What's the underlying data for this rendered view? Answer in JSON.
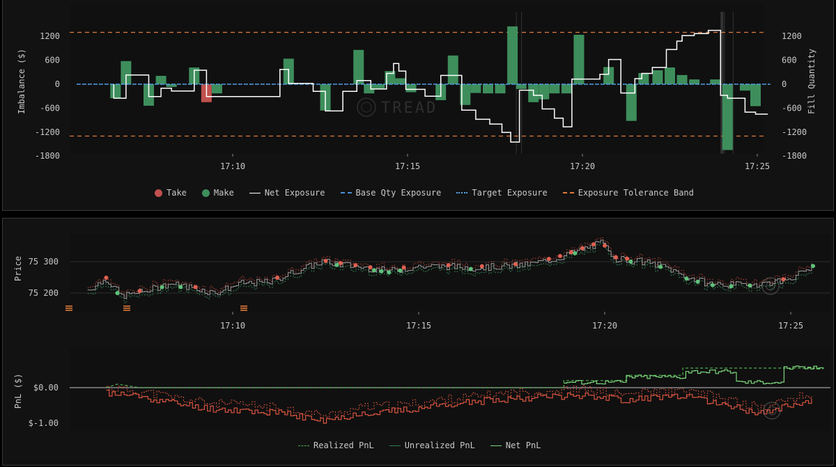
{
  "colors": {
    "take": "#c0504d",
    "make": "#3e8e5c",
    "net_exposure": "#ffffff",
    "base_qty": "#4a90d9",
    "target": "#5aa5e6",
    "tolerance": "#e07b39",
    "realized_pnl": "#4caf50",
    "unrealized_pnl": "#2e7d4f",
    "net_pnl": "#7cd67c",
    "pnl_negative": "#d9543f"
  },
  "chart_data": [
    {
      "type": "bar",
      "panel": "exposure",
      "ylabel_left": "Imbalance ($)",
      "ylabel_right": "Fill Quantity",
      "yticks": [
        "1200",
        "600",
        "0",
        "-600",
        "-1200",
        "-1800"
      ],
      "ylim": [
        -1800,
        1500
      ],
      "xticks": [
        "17:10",
        "17:15",
        "17:20",
        "17:25"
      ],
      "tolerance_band": [
        1300,
        -1300
      ],
      "legend": [
        "Take",
        "Make",
        "Net Exposure",
        "Base Qty Exposure",
        "Target Exposure",
        "Exposure Tolerance Band"
      ],
      "fills": [
        {
          "t": 6.65,
          "v": -350,
          "side": "make"
        },
        {
          "t": 6.95,
          "v": 580,
          "side": "make"
        },
        {
          "t": 7.6,
          "v": -540,
          "side": "make"
        },
        {
          "t": 7.95,
          "v": 210,
          "side": "make"
        },
        {
          "t": 8.25,
          "v": -70,
          "side": "make"
        },
        {
          "t": 8.9,
          "v": 420,
          "side": "make"
        },
        {
          "t": 9.25,
          "v": -450,
          "side": "take"
        },
        {
          "t": 9.55,
          "v": -230,
          "side": "make"
        },
        {
          "t": 11.6,
          "v": 640,
          "side": "make"
        },
        {
          "t": 12.65,
          "v": -660,
          "side": "make"
        },
        {
          "t": 13.6,
          "v": 860,
          "side": "make"
        },
        {
          "t": 13.9,
          "v": -230,
          "side": "make"
        },
        {
          "t": 14.2,
          "v": -110,
          "side": "make"
        },
        {
          "t": 14.5,
          "v": 330,
          "side": "make"
        },
        {
          "t": 14.8,
          "v": 150,
          "side": "make"
        },
        {
          "t": 15.1,
          "v": -200,
          "side": "make"
        },
        {
          "t": 15.95,
          "v": -400,
          "side": "make"
        },
        {
          "t": 16.3,
          "v": 720,
          "side": "make"
        },
        {
          "t": 16.65,
          "v": -520,
          "side": "make"
        },
        {
          "t": 16.95,
          "v": -220,
          "side": "make"
        },
        {
          "t": 17.3,
          "v": -230,
          "side": "make"
        },
        {
          "t": 17.65,
          "v": -230,
          "side": "make"
        },
        {
          "t": 18.0,
          "v": 1450,
          "side": "make"
        },
        {
          "t": 18.25,
          "v": -120,
          "side": "make"
        },
        {
          "t": 18.6,
          "v": -450,
          "side": "make"
        },
        {
          "t": 18.9,
          "v": -380,
          "side": "make"
        },
        {
          "t": 19.2,
          "v": -230,
          "side": "make"
        },
        {
          "t": 19.55,
          "v": -230,
          "side": "make"
        },
        {
          "t": 19.9,
          "v": 1240,
          "side": "make"
        },
        {
          "t": 20.75,
          "v": 430,
          "side": "make"
        },
        {
          "t": 21.4,
          "v": -920,
          "side": "make"
        },
        {
          "t": 21.75,
          "v": 280,
          "side": "make"
        },
        {
          "t": 22.15,
          "v": 350,
          "side": "make"
        },
        {
          "t": 22.5,
          "v": 420,
          "side": "make"
        },
        {
          "t": 22.85,
          "v": 230,
          "side": "make"
        },
        {
          "t": 23.2,
          "v": 120,
          "side": "make"
        },
        {
          "t": 23.8,
          "v": 120,
          "side": "make"
        },
        {
          "t": 24.15,
          "v": -1650,
          "side": "make"
        },
        {
          "t": 24.65,
          "v": -160,
          "side": "make"
        },
        {
          "t": 24.95,
          "v": -550,
          "side": "make"
        }
      ],
      "net_exposure": [
        [
          6.6,
          0
        ],
        [
          6.6,
          -350
        ],
        [
          6.95,
          -350
        ],
        [
          6.95,
          230
        ],
        [
          7.6,
          230
        ],
        [
          7.6,
          -310
        ],
        [
          7.95,
          -310
        ],
        [
          7.95,
          -100
        ],
        [
          8.25,
          -100
        ],
        [
          8.25,
          -170
        ],
        [
          8.9,
          -170
        ],
        [
          8.9,
          350
        ],
        [
          9.25,
          350
        ],
        [
          9.25,
          -310
        ],
        [
          11.35,
          -310
        ],
        [
          11.35,
          370
        ],
        [
          11.6,
          370
        ],
        [
          11.6,
          20
        ],
        [
          12.3,
          20
        ],
        [
          12.3,
          -180
        ],
        [
          12.65,
          -180
        ],
        [
          12.65,
          -670
        ],
        [
          13.15,
          -670
        ],
        [
          13.15,
          -180
        ],
        [
          13.55,
          -180
        ],
        [
          13.55,
          90
        ],
        [
          13.95,
          90
        ],
        [
          13.95,
          -120
        ],
        [
          14.4,
          -120
        ],
        [
          14.4,
          270
        ],
        [
          14.6,
          270
        ],
        [
          14.6,
          520
        ],
        [
          14.75,
          520
        ],
        [
          14.75,
          330
        ],
        [
          14.95,
          330
        ],
        [
          14.95,
          -130
        ],
        [
          15.5,
          -130
        ],
        [
          15.5,
          -300
        ],
        [
          15.95,
          -300
        ],
        [
          15.95,
          220
        ],
        [
          16.55,
          220
        ],
        [
          16.55,
          -650
        ],
        [
          16.95,
          -650
        ],
        [
          16.95,
          -880
        ],
        [
          17.35,
          -880
        ],
        [
          17.35,
          -1000
        ],
        [
          17.7,
          -1000
        ],
        [
          17.7,
          -1210
        ],
        [
          17.95,
          -1210
        ],
        [
          17.95,
          -1450
        ],
        [
          18.2,
          -1450
        ],
        [
          18.2,
          -150
        ],
        [
          18.6,
          -150
        ],
        [
          18.6,
          -280
        ],
        [
          18.85,
          -280
        ],
        [
          18.85,
          -620
        ],
        [
          19.2,
          -620
        ],
        [
          19.2,
          -850
        ],
        [
          19.45,
          -850
        ],
        [
          19.45,
          -1070
        ],
        [
          19.7,
          -1070
        ],
        [
          19.7,
          130
        ],
        [
          20.5,
          130
        ],
        [
          20.5,
          250
        ],
        [
          20.75,
          250
        ],
        [
          20.75,
          620
        ],
        [
          21.1,
          620
        ],
        [
          21.1,
          -220
        ],
        [
          21.5,
          -220
        ],
        [
          21.5,
          140
        ],
        [
          21.7,
          140
        ],
        [
          21.7,
          270
        ],
        [
          22.0,
          270
        ],
        [
          22.0,
          420
        ],
        [
          22.4,
          420
        ],
        [
          22.4,
          870
        ],
        [
          22.7,
          870
        ],
        [
          22.7,
          1080
        ],
        [
          22.85,
          1080
        ],
        [
          22.85,
          1220
        ],
        [
          23.2,
          1220
        ],
        [
          23.2,
          1270
        ],
        [
          23.6,
          1270
        ],
        [
          23.6,
          1350
        ],
        [
          23.95,
          1350
        ],
        [
          23.95,
          -280
        ],
        [
          24.15,
          -280
        ],
        [
          24.15,
          -350
        ],
        [
          24.65,
          -350
        ],
        [
          24.65,
          -700
        ],
        [
          24.95,
          -700
        ],
        [
          24.95,
          -750
        ],
        [
          25.3,
          -750
        ]
      ]
    },
    {
      "type": "line",
      "panel": "price",
      "ylabel": "Price",
      "yticks": [
        "75 300",
        "75 200"
      ],
      "ylim": [
        75150,
        75400
      ],
      "xticks": [
        "17:10",
        "17:15",
        "17:20",
        "17:25"
      ]
    },
    {
      "type": "line",
      "panel": "pnl",
      "ylabel": "PnL ($)",
      "yticks": [
        "$0.00",
        "$-1.00"
      ],
      "ylim": [
        -1.2,
        0.7
      ],
      "legend": [
        "Realized PnL",
        "Unrealized PnL",
        "Net PnL"
      ]
    }
  ],
  "watermark": {
    "text": "TREAD"
  }
}
